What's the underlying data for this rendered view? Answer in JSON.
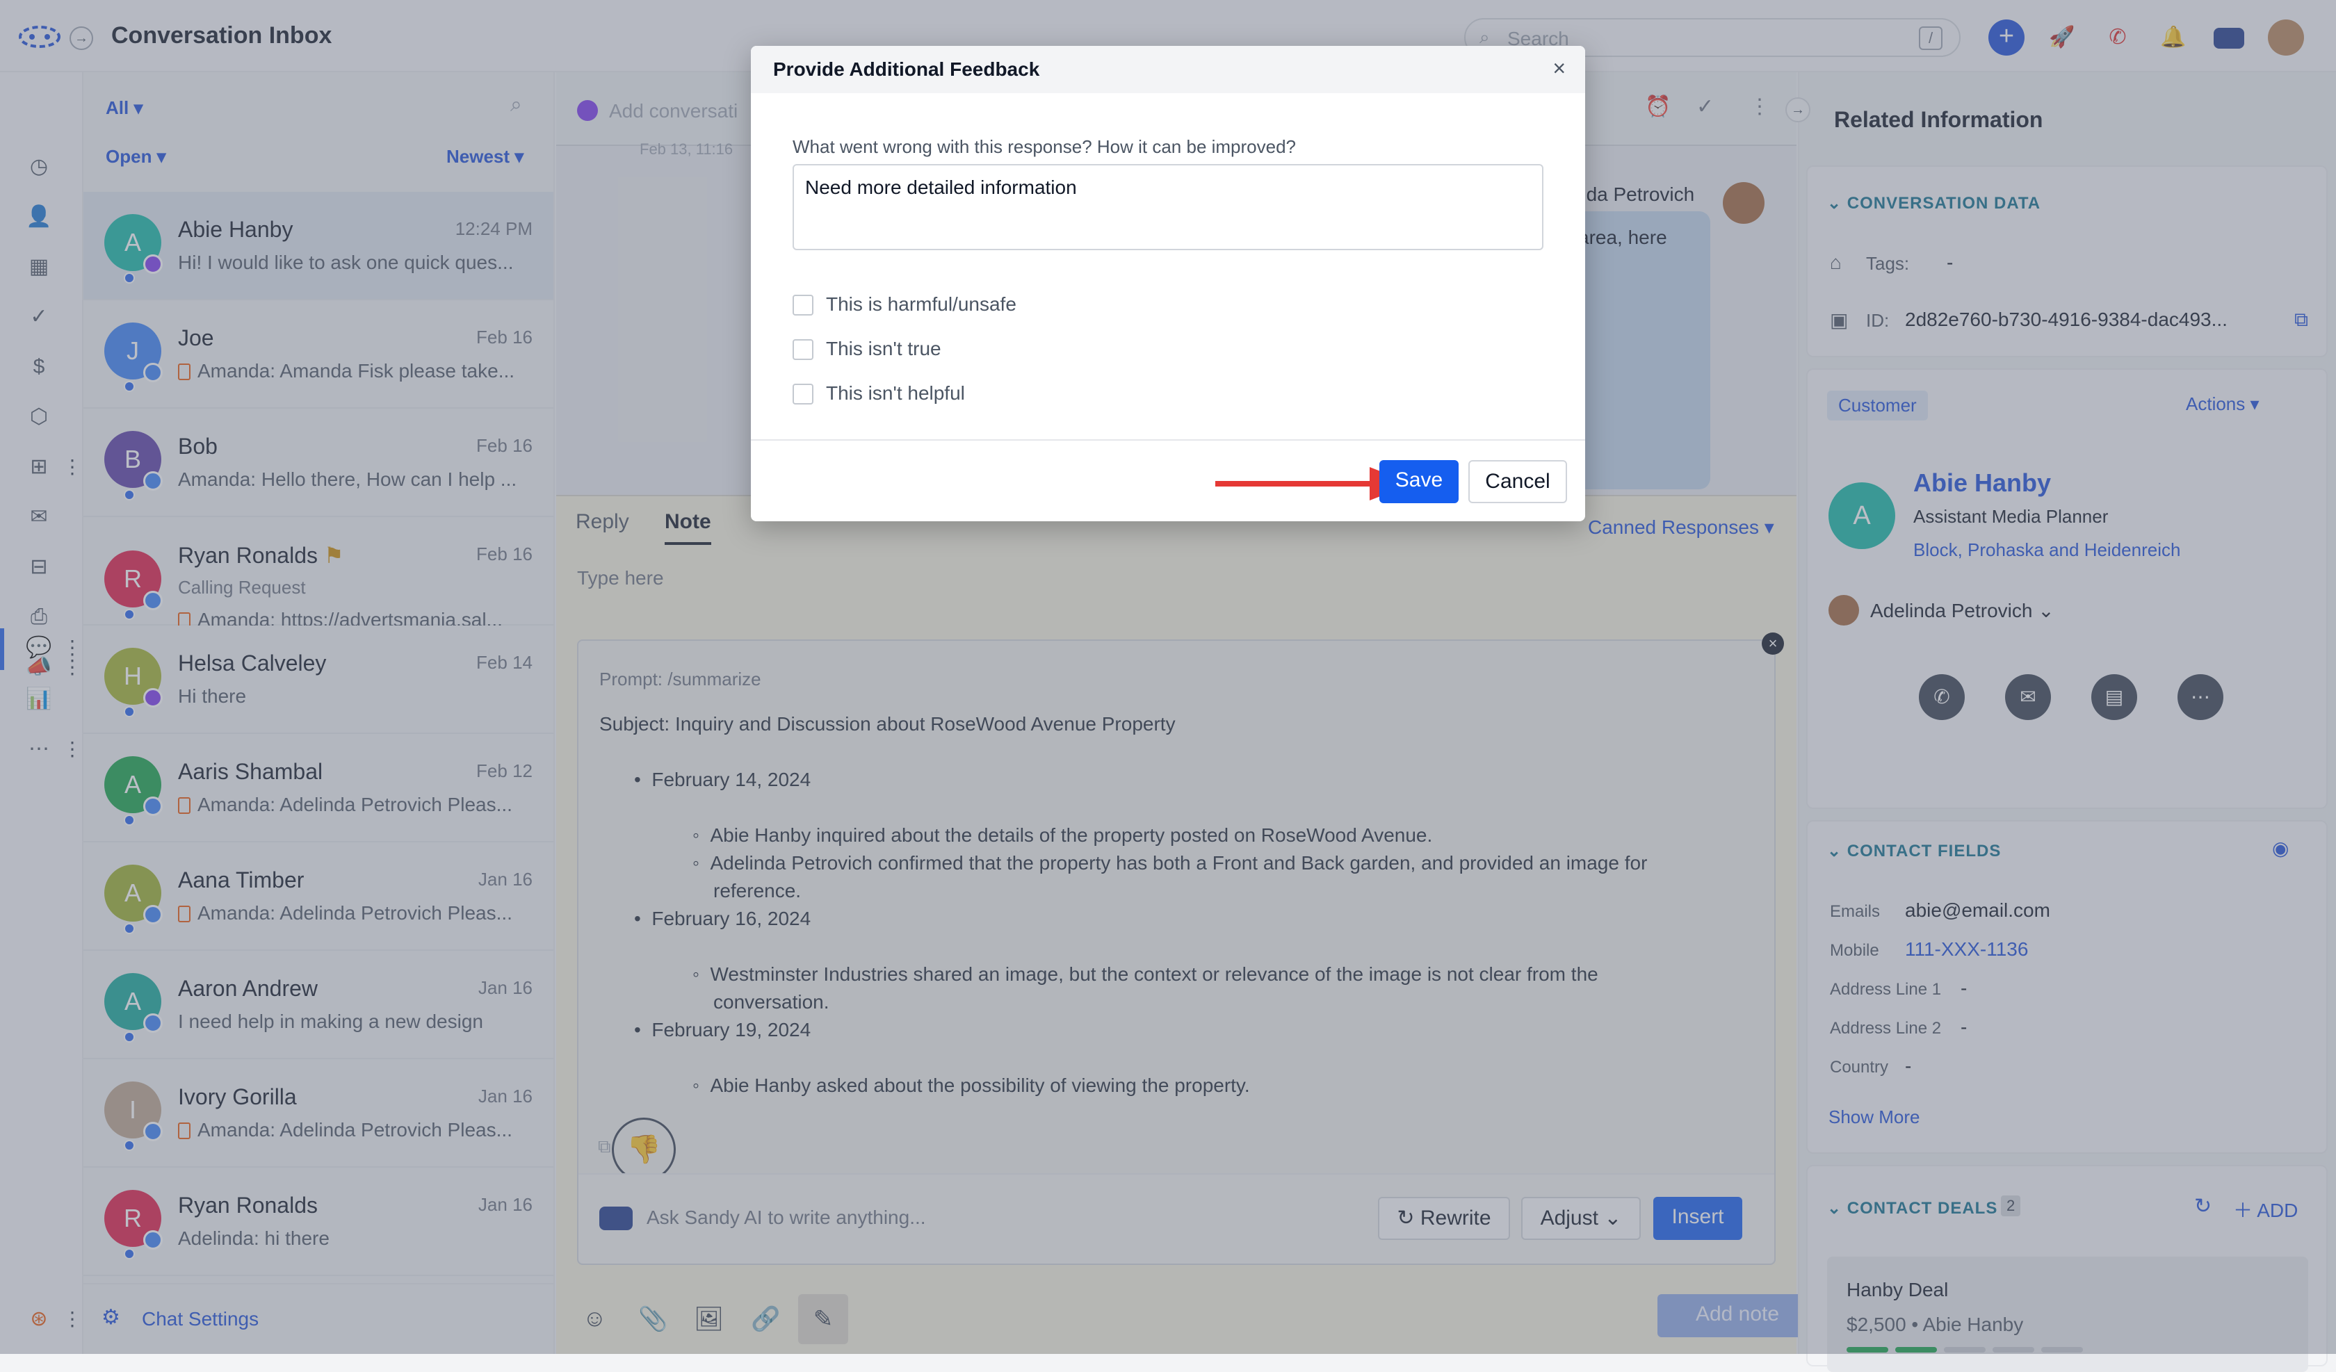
{
  "app": {
    "title": "Conversation Inbox",
    "search_placeholder": "Search",
    "search_shortcut": "/"
  },
  "list": {
    "filter_all": "All",
    "filter_status": "Open",
    "filter_sort": "Newest",
    "items": [
      {
        "initial": "A",
        "name": "Abie Hanby",
        "date": "12:24 PM",
        "preview": "Hi! I would like to ask one quick ques...",
        "color": "#14b8a6"
      },
      {
        "initial": "J",
        "name": "Joe",
        "date": "Feb 16",
        "preview": "Amanda: Amanda Fisk please take...",
        "color": "#3b82f6"
      },
      {
        "initial": "B",
        "name": "Bob",
        "date": "Feb 16",
        "preview": "Amanda: Hello there, How can I help ...",
        "color": "#5b3fa6"
      },
      {
        "initial": "R",
        "name": "Ryan Ronalds",
        "date": "Feb 16",
        "sub": "Calling Request",
        "preview": "Amanda: https://advertsmania.sal...",
        "color": "#e11d48"
      },
      {
        "initial": "H",
        "name": "Helsa Calveley",
        "date": "Feb 14",
        "preview": "Hi there",
        "color": "#a3b330"
      },
      {
        "initial": "A",
        "name": "Aaris Shambal",
        "date": "Feb 12",
        "preview": "Amanda: Adelinda Petrovich Pleas...",
        "color": "#16a34a"
      },
      {
        "initial": "A",
        "name": "Aana Timber",
        "date": "Jan 16",
        "preview": "Amanda: Adelinda Petrovich Pleas...",
        "color": "#9bb02f"
      },
      {
        "initial": "A",
        "name": "Aaron Andrew",
        "date": "Jan 16",
        "preview": "I need help in making a new design",
        "color": "#14a89a"
      },
      {
        "initial": "I",
        "name": "Ivory Gorilla",
        "date": "Jan 16",
        "preview": "Amanda: Adelinda Petrovich Pleas...",
        "color": "#bca58f"
      },
      {
        "initial": "R",
        "name": "Ryan Ronalds",
        "date": "Jan 16",
        "preview": "Adelinda: hi there",
        "color": "#e11d48"
      }
    ],
    "chat_settings": "Chat Settings"
  },
  "chat": {
    "add_placeholder": "Add conversati",
    "date_stub": "Feb 13, 11:16",
    "agent_name_stub": "nda Petrovich",
    "bubble_stub": "area, here"
  },
  "composer": {
    "tab_reply": "Reply",
    "tab_note": "Note",
    "canned": "Canned Responses",
    "type_here": "Type here",
    "prompt": "Prompt: /summarize",
    "subject": "Subject: Inquiry and Discussion about RoseWood Avenue Property",
    "date1": "February 14, 2024",
    "item1a": "Abie Hanby inquired about the details of the property posted on RoseWood Avenue.",
    "item1b_line1": "Adelinda Petrovich confirmed that the property has both a Front and Back garden, and provided an image for",
    "item1b_line2": "reference.",
    "date2": "February 16, 2024",
    "item2a_line1": "Westminster Industries shared an image, but the context or relevance of the image is not clear from the",
    "item2a_line2": "conversation.",
    "date3": "February 19, 2024",
    "item3a": "Abie Hanby asked about the possibility of viewing the property.",
    "ai_placeholder": "Ask Sandy AI to write anything...",
    "rewrite": "Rewrite",
    "adjust": "Adjust",
    "insert": "Insert",
    "add_note": "Add note"
  },
  "right": {
    "title": "Related Information",
    "conv_data": "CONVERSATION DATA",
    "tags_label": "Tags:",
    "tags_value": "-",
    "id_label": "ID:",
    "id_value": "2d82e760-b730-4916-9384-dac493...",
    "customer_tag": "Customer",
    "actions": "Actions",
    "contact_initial": "A",
    "contact_name": "Abie Hanby",
    "contact_role": "Assistant Media Planner",
    "contact_company": "Block, Prohaska and Heidenreich",
    "owner": "Adelinda Petrovich",
    "contact_fields": "CONTACT FIELDS",
    "fields": [
      {
        "label": "Emails",
        "value": "abie@email.com"
      },
      {
        "label": "Mobile",
        "value": "111-XXX-1136"
      },
      {
        "label": "Address Line 1",
        "value": "-"
      },
      {
        "label": "Address Line 2",
        "value": "-"
      },
      {
        "label": "Country",
        "value": "-"
      }
    ],
    "show_more": "Show More",
    "contact_deals": "CONTACT DEALS",
    "deals_count": "2",
    "add": "ADD",
    "deal_name": "Hanby Deal",
    "deal_amount": "$2,500",
    "deal_owner": "Abie Hanby",
    "deal2_stub": "Hanby Deal",
    "deal_progress": 0.4
  },
  "modal": {
    "title": "Provide Additional Feedback",
    "question": "What went wrong with this response? How it can be improved?",
    "answer": "Need more detailed information",
    "options": [
      "This is harmful/unsafe",
      "This isn't true",
      "This isn't helpful"
    ],
    "save": "Save",
    "cancel": "Cancel"
  },
  "colors": {
    "accent": "#2563eb",
    "brand": "#155eef",
    "teal_header": "#0f6e8c",
    "red_arrow": "#e53935"
  }
}
